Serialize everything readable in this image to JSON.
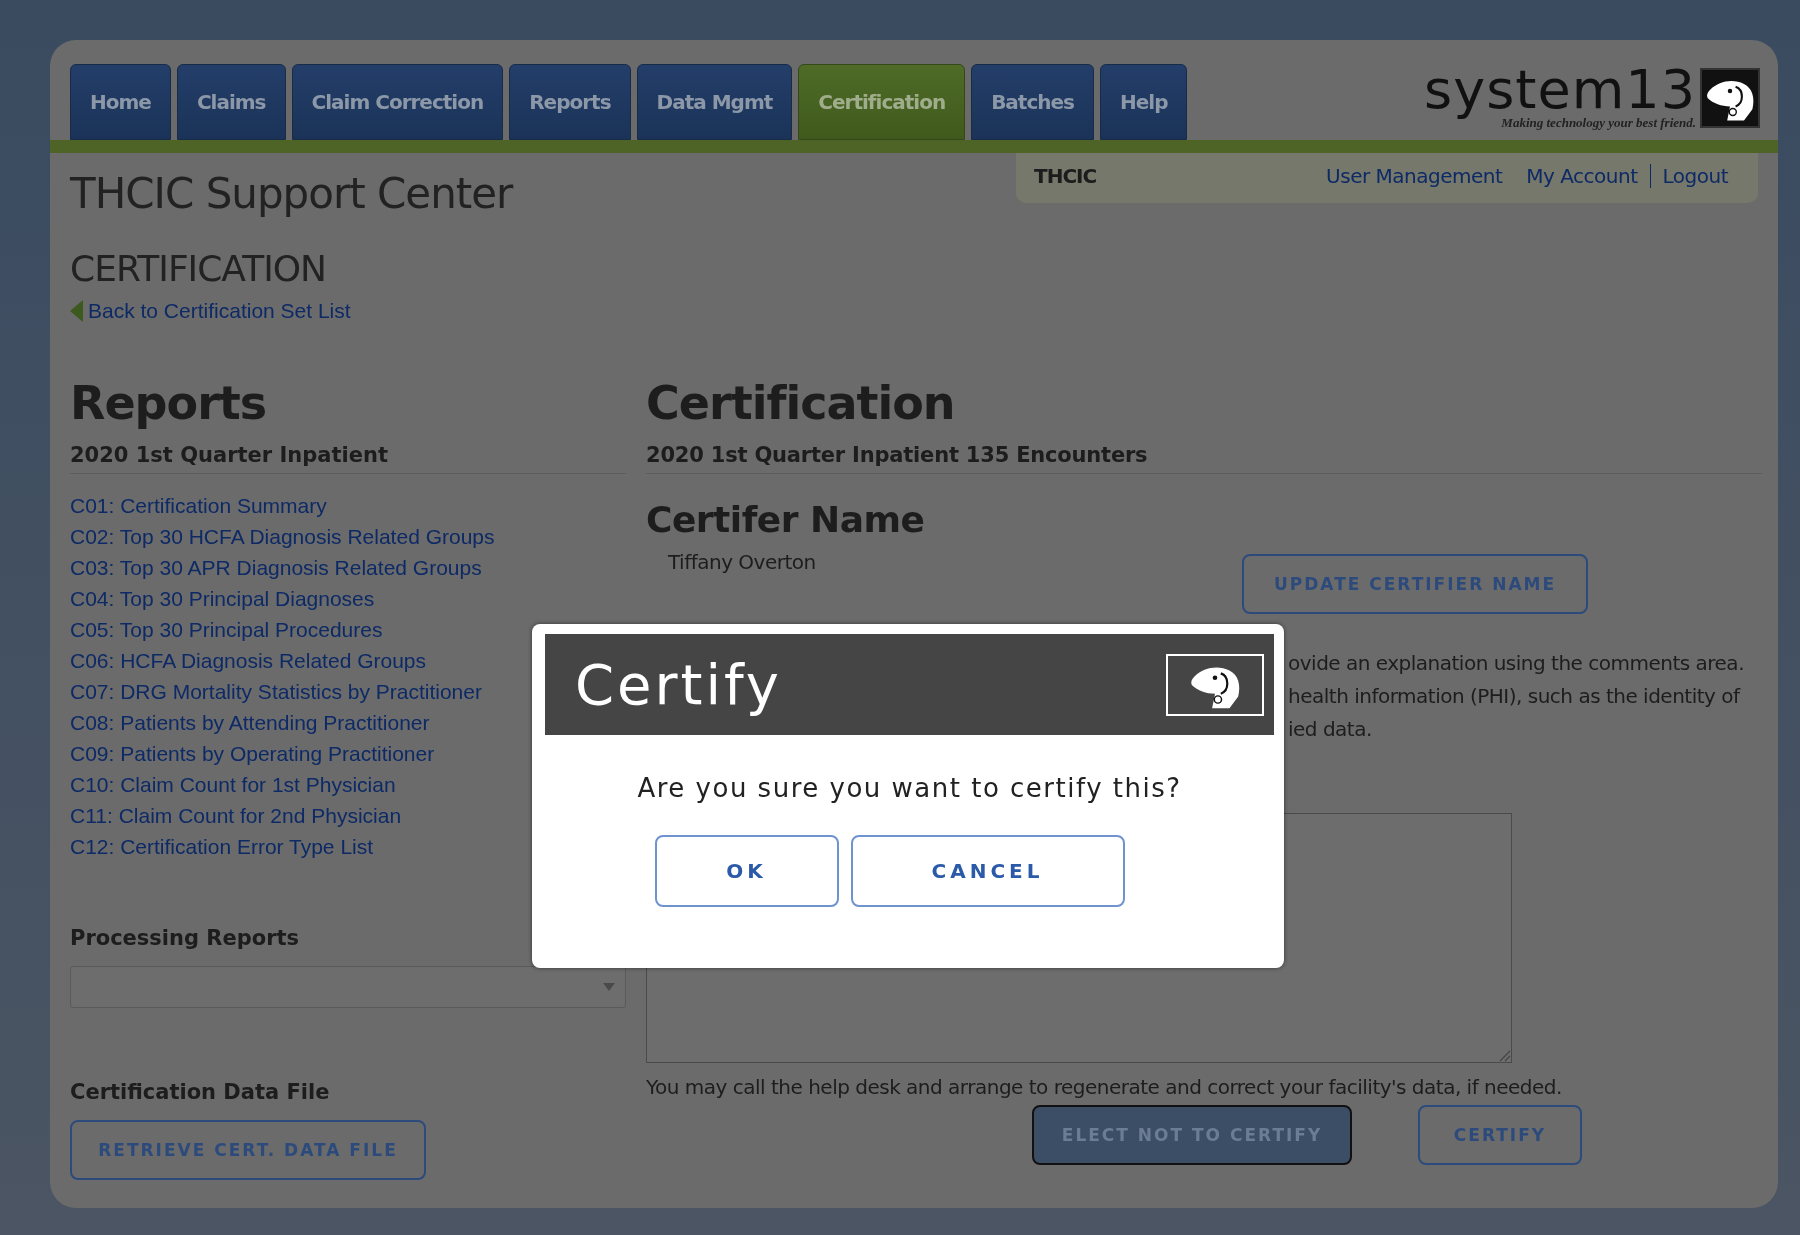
{
  "nav": {
    "tabs": [
      {
        "label": "Home",
        "selected": false
      },
      {
        "label": "Claims",
        "selected": false
      },
      {
        "label": "Claim Correction",
        "selected": false
      },
      {
        "label": "Reports",
        "selected": false
      },
      {
        "label": "Data Mgmt",
        "selected": false
      },
      {
        "label": "Certification",
        "selected": true
      },
      {
        "label": "Batches",
        "selected": false
      },
      {
        "label": "Help",
        "selected": false
      }
    ],
    "logo": {
      "name": "system13",
      "tagline": "Making technology your best friend."
    }
  },
  "account_bar": {
    "organization": "THCIC",
    "links": [
      "User Management",
      "My Account",
      "Logout"
    ]
  },
  "page": {
    "title": "THCIC Support Center",
    "section": "CERTIFICATION",
    "back_link": "Back to Certification Set List"
  },
  "reports": {
    "heading": "Reports",
    "set_title": "2020 1st Quarter Inpatient",
    "links": [
      "C01: Certification Summary",
      "C02: Top 30 HCFA Diagnosis Related Groups",
      "C03: Top 30 APR Diagnosis Related Groups",
      "C04: Top 30 Principal Diagnoses",
      "C05: Top 30 Principal Procedures",
      "C06: HCFA Diagnosis Related Groups",
      "C07: DRG Mortality Statistics by Practitioner",
      "C08: Patients by Attending Practitioner",
      "C09: Patients by Operating Practitioner",
      "C10: Claim Count for 1st Physician",
      "C11: Claim Count for 2nd Physician",
      "C12: Certification Error Type List"
    ],
    "processing_heading": "Processing Reports",
    "data_file_heading": "Certification Data File",
    "retrieve_button": "RETRIEVE CERT. DATA FILE"
  },
  "certification": {
    "heading": "Certification",
    "subtitle": "2020 1st Quarter Inpatient 135 Encounters",
    "certifier_heading": "Certifer Name",
    "certifier_name": "Tiffany Overton",
    "update_button": "UPDATE CERTIFIER NAME",
    "notes": [
      "ovide an explanation using the comments area.",
      "health information (PHI), such as the identity of",
      "ied data."
    ],
    "help_text": "You may call the help desk and arrange to regenerate and correct your facility's data, if needed.",
    "buttons": [
      {
        "label": "ELECT NOT TO CERTIFY",
        "kind": "filled"
      },
      {
        "label": "CERTIFY",
        "kind": "outline"
      }
    ]
  },
  "dialog": {
    "title": "Certify",
    "message": "Are you sure you want to certify this?",
    "buttons": [
      "OK",
      "CANCEL"
    ]
  }
}
